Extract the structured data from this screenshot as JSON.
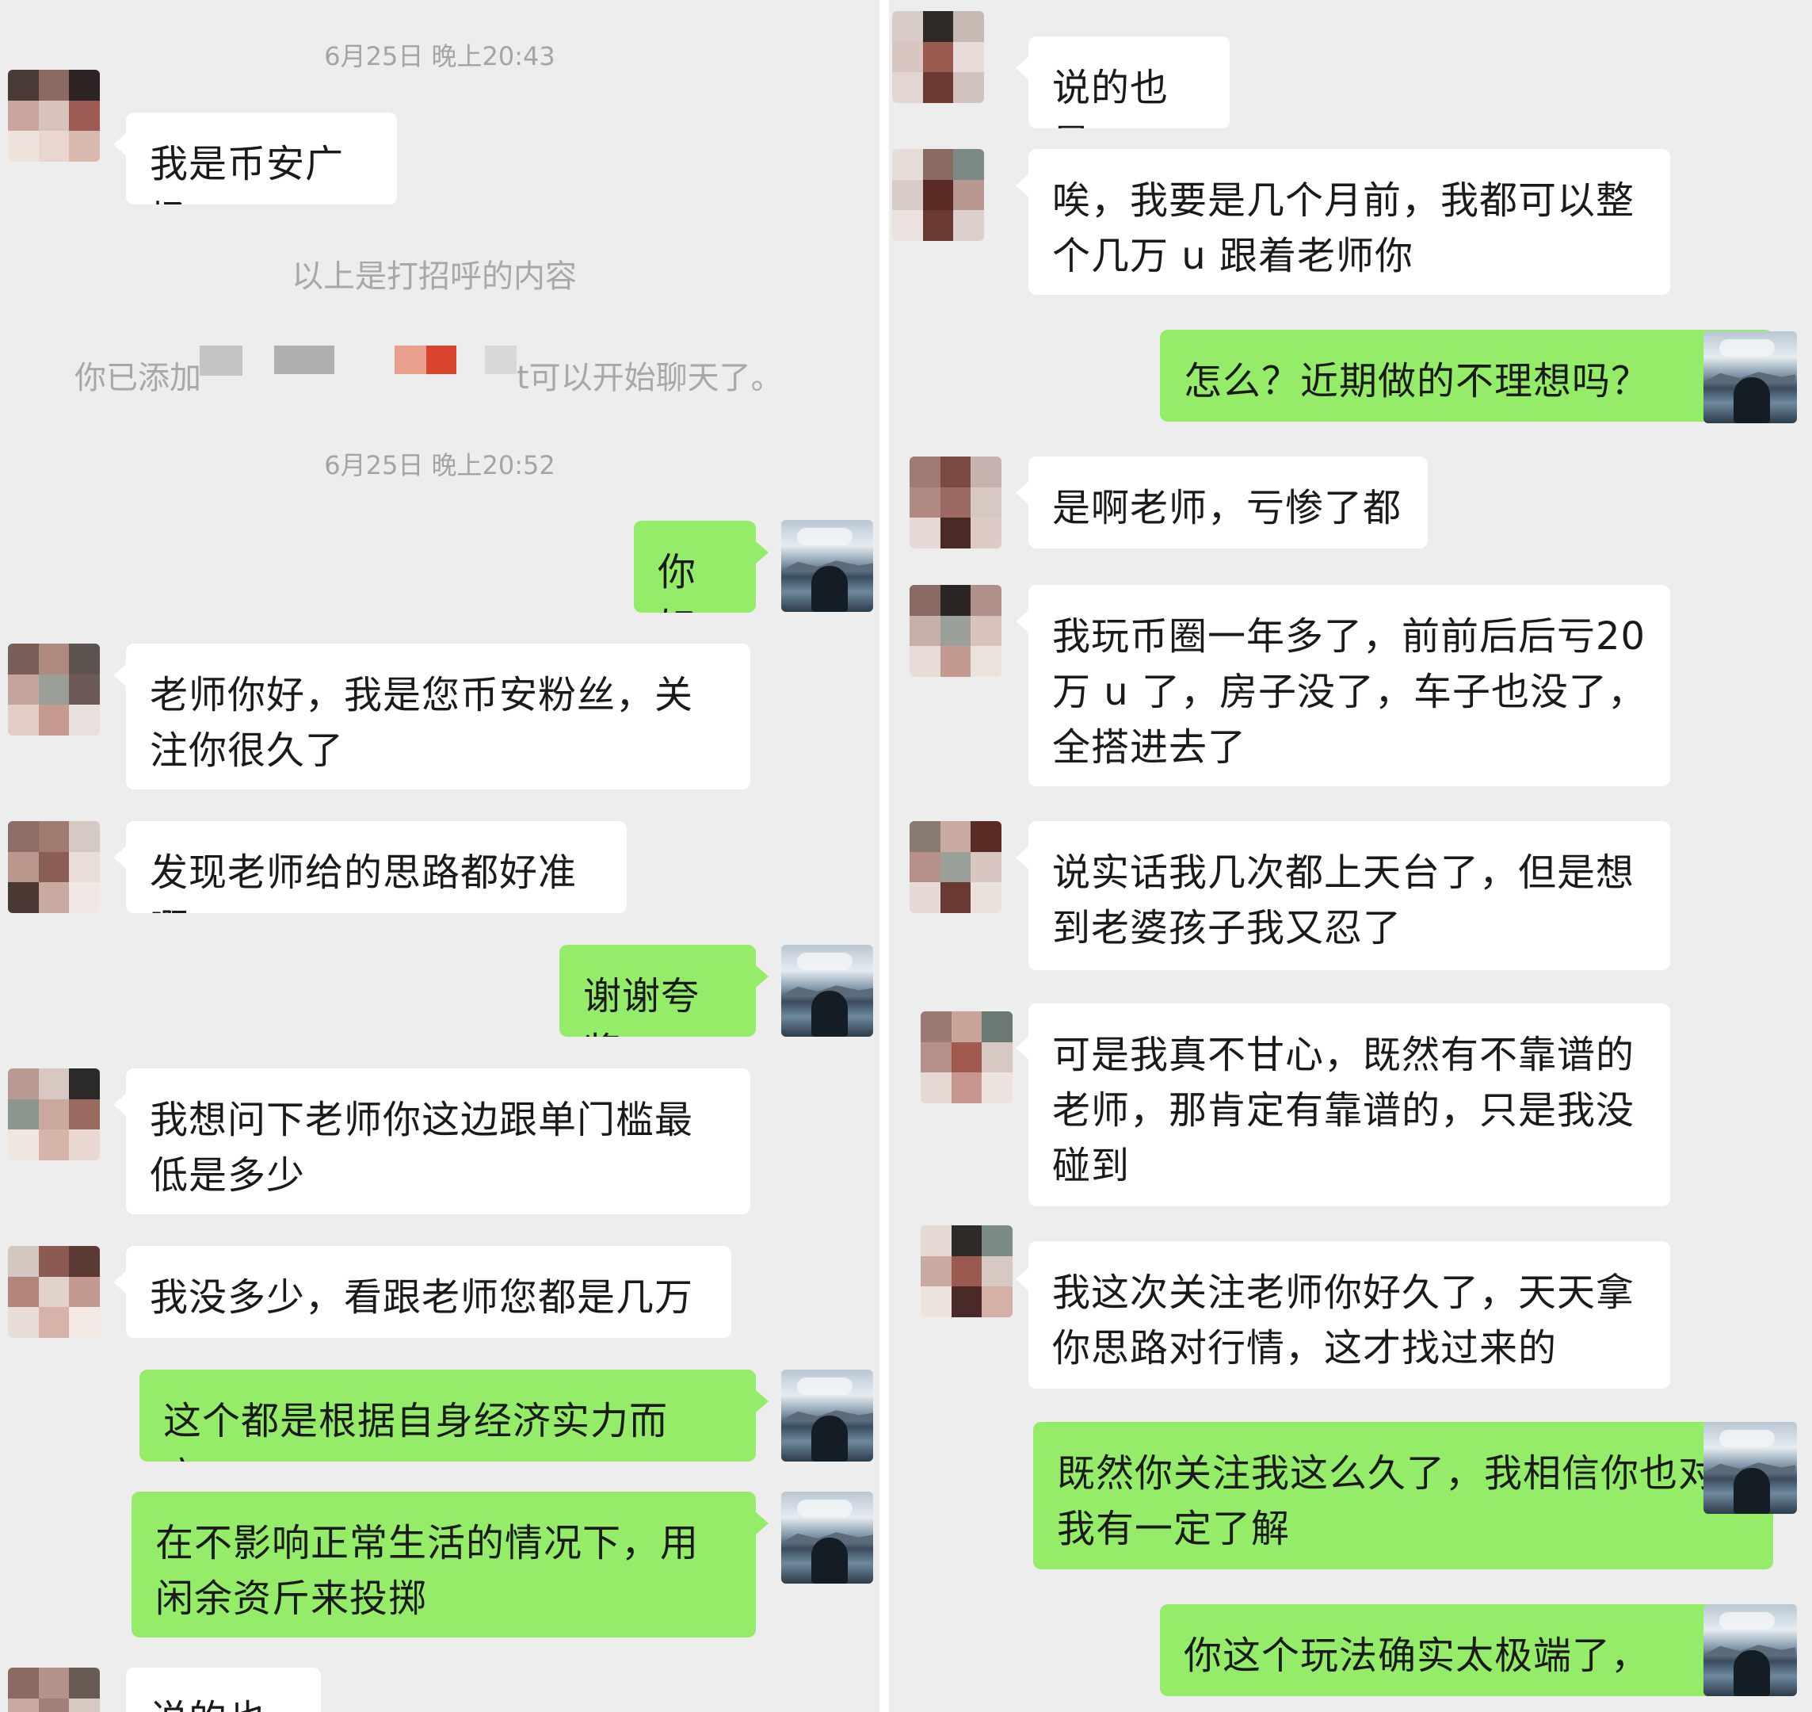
{
  "left": {
    "timestamps": [
      "6月25日 晚上20:43",
      "6月25日 晚上20:52"
    ],
    "system_greeting_note": "以上是打招呼的内容",
    "system_added_prefix": "你已添加",
    "system_added_suffix": "t可以开始聊天了。",
    "messages": [
      {
        "side": "in",
        "text": "我是币安广场"
      },
      {
        "side": "out",
        "text": "你好"
      },
      {
        "side": "in",
        "text": "老师你好，我是您币安粉丝，关注你很久了"
      },
      {
        "side": "in",
        "text": "发现老师给的思路都好准啊"
      },
      {
        "side": "out",
        "text": "谢谢夸奖"
      },
      {
        "side": "in",
        "text": "我想问下老师你这边跟单门槛最低是多少"
      },
      {
        "side": "in",
        "text": "我没多少，看跟老师您都是几万 u"
      },
      {
        "side": "out",
        "text": "这个都是根据自身经济实力而定，"
      },
      {
        "side": "out",
        "text": "在不影响正常生活的情况下，用闲余资斤来投掷"
      },
      {
        "side": "in",
        "text": "说的也是"
      }
    ]
  },
  "right": {
    "messages": [
      {
        "side": "in",
        "text": "说的也是"
      },
      {
        "side": "in",
        "text": "唉，我要是几个月前，我都可以整个几万 u 跟着老师你"
      },
      {
        "side": "out",
        "text": "怎么？近期做的不理想吗？"
      },
      {
        "side": "in",
        "text": "是啊老师，亏惨了都"
      },
      {
        "side": "in",
        "text": "我玩币圈一年多了，前前后后亏20 万 u 了，房子没了，车子也没了，全搭进去了"
      },
      {
        "side": "in",
        "text": "说实话我几次都上天台了，但是想到老婆孩子我又忍了"
      },
      {
        "side": "in",
        "text": "可是我真不甘心，既然有不靠谱的老师，那肯定有靠谱的，只是我没碰到"
      },
      {
        "side": "in",
        "text": "我这次关注老师你好久了，天天拿你思路对行情，这才找过来的"
      },
      {
        "side": "out",
        "text": "既然你关注我这么久了，我相信你也对我有一定了解"
      },
      {
        "side": "out",
        "text": "你这个玩法确实太极端了，"
      }
    ]
  },
  "colors": {
    "panel_bg": "#ededed",
    "incoming_bubble": "#ffffff",
    "outgoing_bubble": "#95ec69",
    "timestamp_text": "#a4a4a4"
  }
}
